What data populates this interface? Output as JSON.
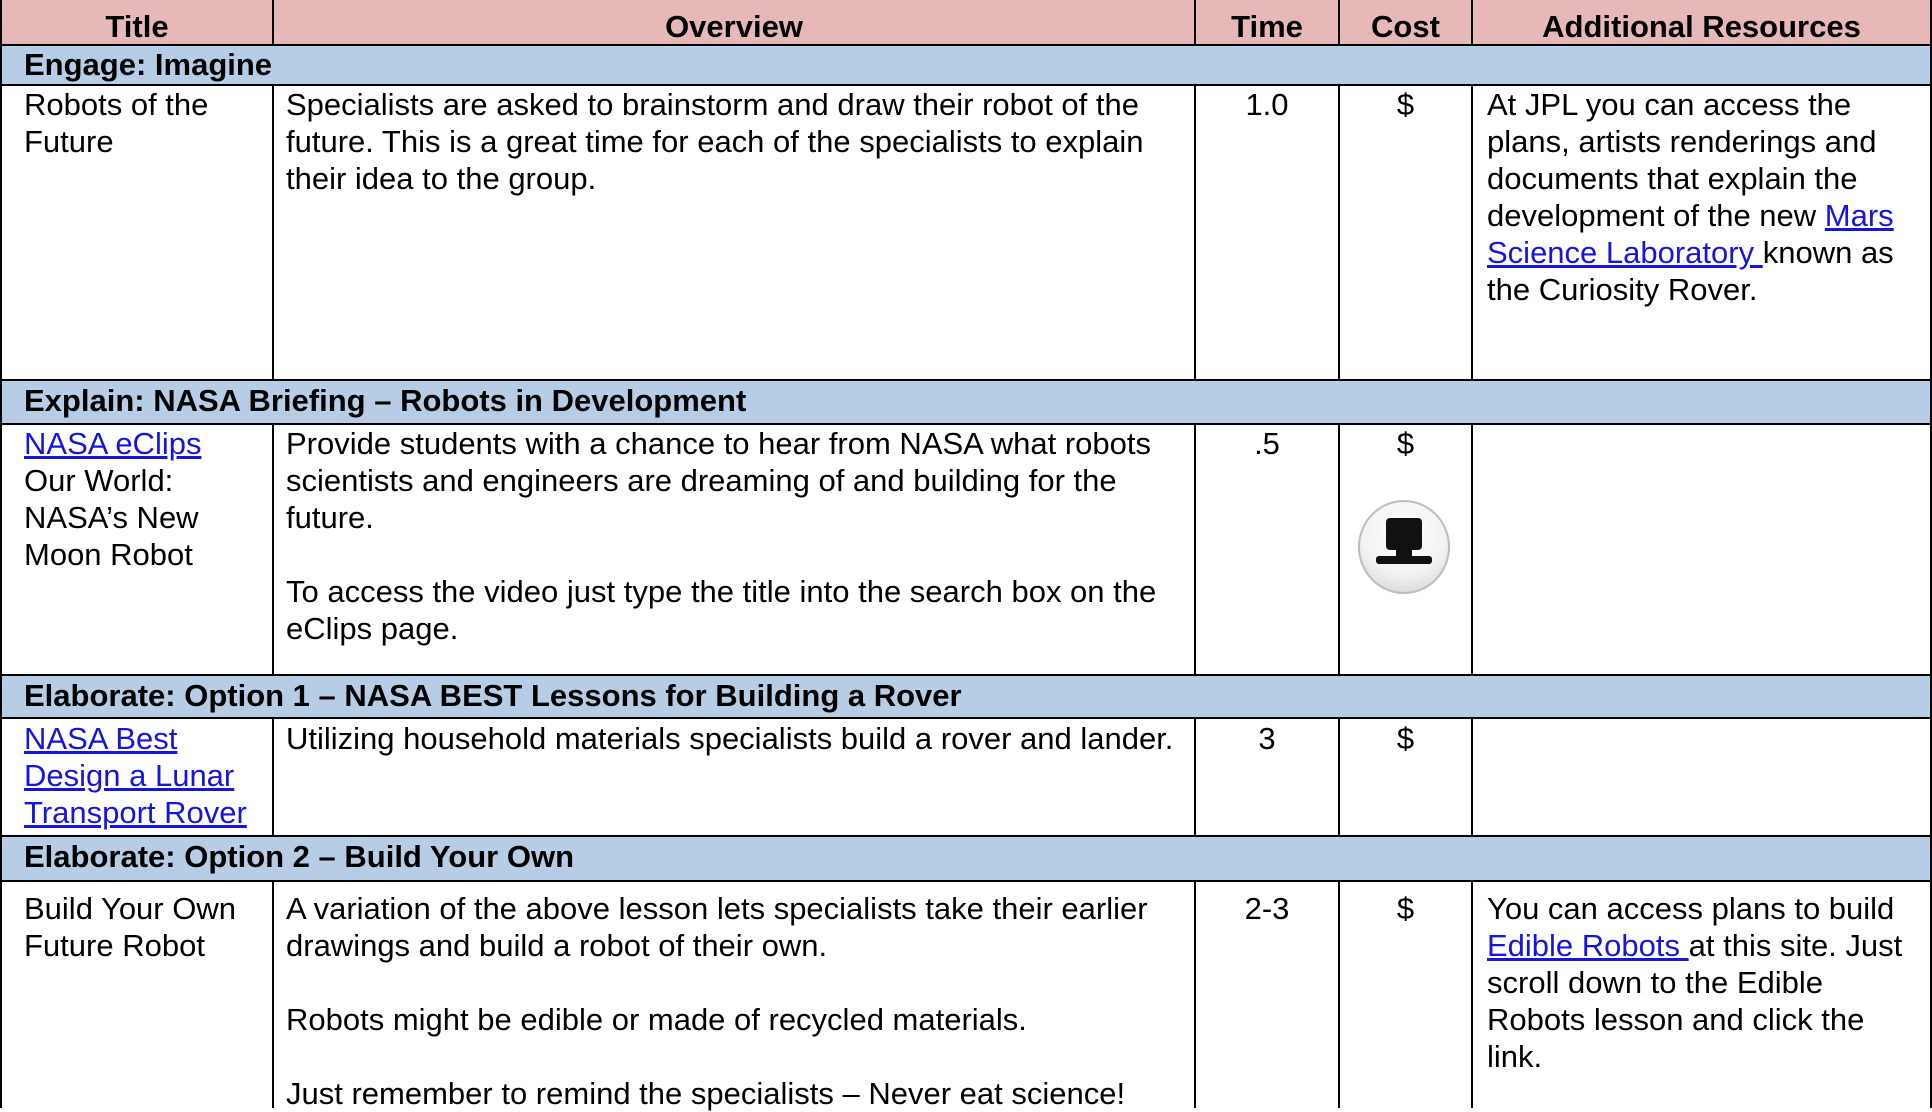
{
  "headers": {
    "title": "Title",
    "overview": "Overview",
    "time": "Time",
    "cost": "Cost",
    "resources": "Additional Resources"
  },
  "sections": [
    {
      "heading": "Engage: Imagine",
      "row": {
        "title": "Robots of the Future",
        "overview": [
          "Specialists are asked to brainstorm and draw their robot of the future. This is a great time for each of the specialists to explain their idea to the group."
        ],
        "time": "1.0",
        "cost": "$",
        "resources": {
          "before": "At JPL you can access the plans, artists renderings and documents that explain the development of the new ",
          "link": "Mars Science Laboratory ",
          "after": "known as the Curiosity Rover."
        }
      }
    },
    {
      "heading": "Explain: NASA Briefing – Robots in Development",
      "row": {
        "title_link": "NASA eClips",
        "title_rest": "Our World: NASA’s New Moon Robot",
        "overview": [
          "Provide students with a chance to hear from NASA what robots scientists and engineers are dreaming of and building for the future.",
          "To access the video just type the title into the search box on the eClips page."
        ],
        "time": ".5",
        "cost": "$",
        "cost_icon": "computer-icon"
      }
    },
    {
      "heading": "Elaborate: Option 1 – NASA BEST Lessons for Building a Rover",
      "row": {
        "title_link": "NASA Best Design a Lunar Transport Rover",
        "overview": [
          "Utilizing household materials specialists build a rover and lander."
        ],
        "time": "3",
        "cost": "$"
      }
    },
    {
      "heading": "Elaborate: Option 2 – Build Your Own",
      "row": {
        "title": "Build Your Own Future Robot",
        "overview": [
          "A variation of the above lesson lets specialists take their earlier drawings and build a robot of their own.",
          "Robots might be edible or made of recycled materials.",
          "Just remember to remind the specialists – Never eat science!"
        ],
        "time": "2-3",
        "cost": "$",
        "resources": {
          "before": "You can access plans to build ",
          "link": "Edible Robots ",
          "after": "at this site. Just scroll down to the Edible Robots lesson and click the link."
        }
      }
    }
  ],
  "colors": {
    "header_bg": "#e7b8b8",
    "section_bg": "#b7cde5",
    "link": "#1515e0"
  }
}
